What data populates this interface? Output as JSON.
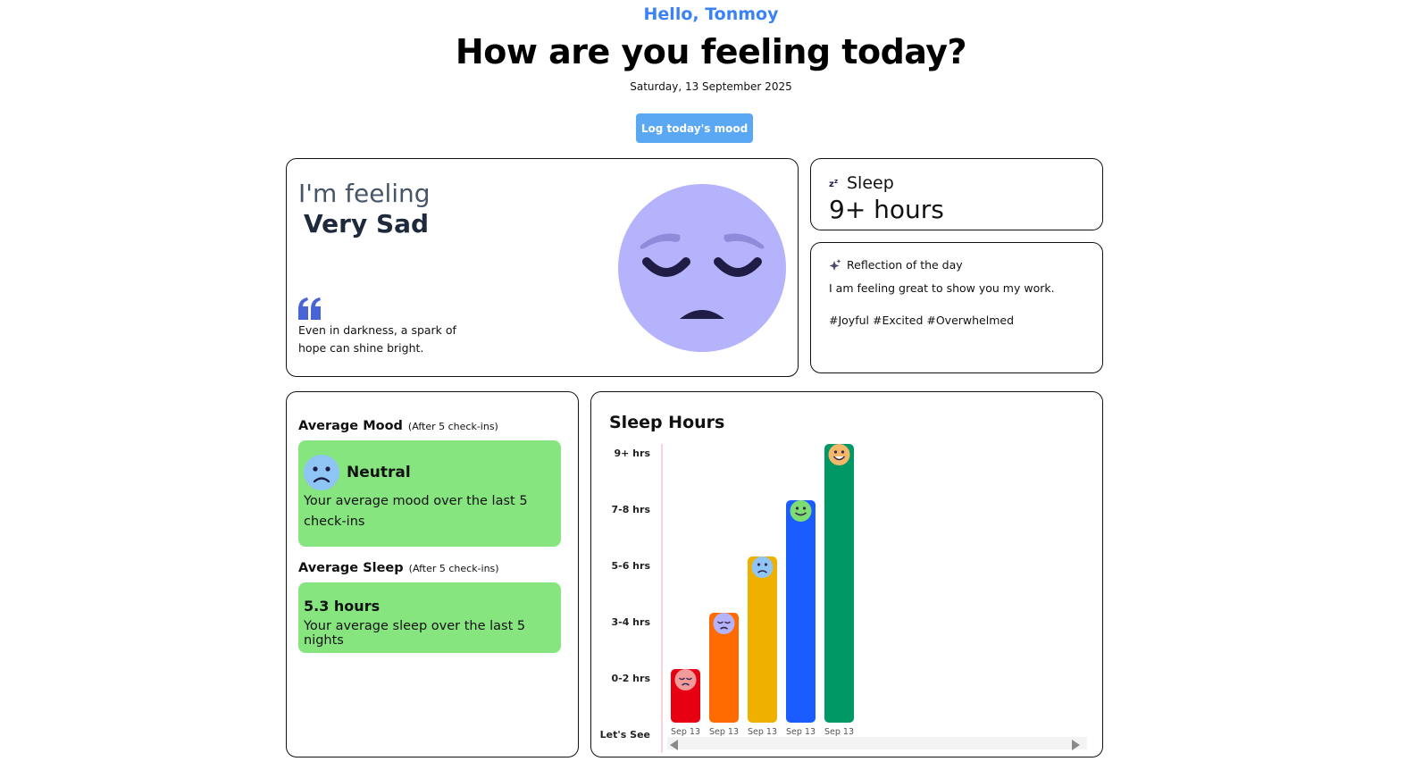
{
  "header": {
    "greeting": "Hello, Tonmoy",
    "headline": "How are you feeling today?",
    "date": "Saturday, 13 September 2025",
    "log_button": "Log today's mood"
  },
  "feeling": {
    "label": "I'm feeling",
    "value": "Very Sad",
    "quote": "Even in darkness, a spark of hope can shine bright.",
    "face_icon": "very-sad-face-icon",
    "face_color": "#b5b3fb",
    "quote_color": "#4865d6"
  },
  "sleep": {
    "icon": "zzz-icon",
    "title": "Sleep",
    "value": "9+ hours"
  },
  "reflection": {
    "icon": "sparkle-icon",
    "title": "Reflection of the day",
    "text": "I am feeling great to show you my work.",
    "tags": "#Joyful #Excited #Overwhelmed"
  },
  "average": {
    "mood_title": "Average Mood",
    "mood_sub": "(After 5 check-ins)",
    "mood_name": "Neutral",
    "mood_desc": "Your average mood over the last 5 check-ins",
    "sleep_title": "Average Sleep",
    "sleep_sub": "(After 5 check-ins)",
    "sleep_value": "5.3 hours",
    "sleep_desc": "Your average sleep over the last 5 nights",
    "box_color": "#86e57f"
  },
  "chart_data": {
    "type": "bar",
    "title": "Sleep Hours",
    "y_categories": [
      "Let's See",
      "0-2 hrs",
      "3-4 hrs",
      "5-6 hrs",
      "7-8 hrs",
      "9+ hrs"
    ],
    "categories": [
      "Sep 13",
      "Sep 13",
      "Sep 13",
      "Sep 13",
      "Sep 13"
    ],
    "values": [
      "0-2 hrs",
      "3-4 hrs",
      "5-6 hrs",
      "7-8 hrs",
      "9+ hrs"
    ],
    "bar_colors": [
      "#e60012",
      "#ff6b00",
      "#efb000",
      "#1a5cff",
      "#009966"
    ],
    "moods": [
      "very-sad",
      "sad",
      "neutral",
      "happy",
      "very-happy"
    ]
  }
}
